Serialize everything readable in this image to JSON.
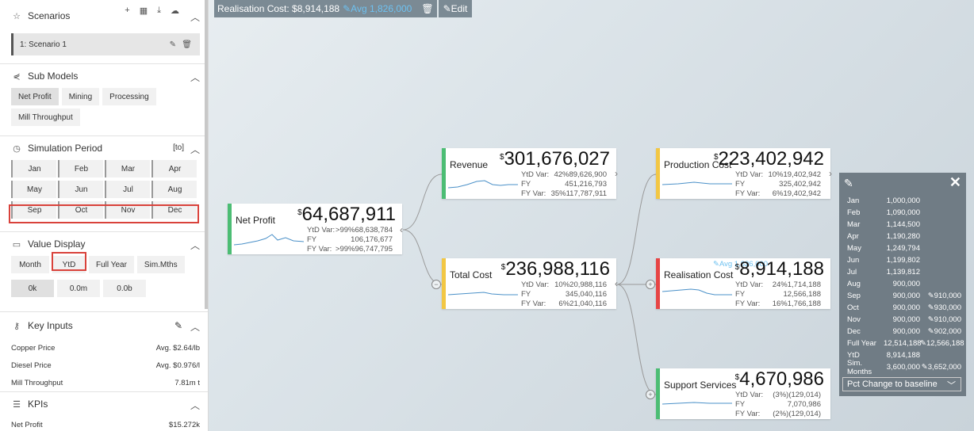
{
  "topbar": {
    "realisation": "Realisation Cost: $8,914,188",
    "avg": "Avg 1,826,000",
    "edit": "Edit"
  },
  "sidebar": {
    "scenarios": {
      "title": "Scenarios",
      "item": "1: Scenario 1"
    },
    "submodels": {
      "title": "Sub Models",
      "items": [
        "Net Profit",
        "Mining",
        "Processing",
        "Mill Throughput"
      ]
    },
    "period": {
      "title": "Simulation Period",
      "to": "[to]",
      "months": [
        "Jan",
        "Feb",
        "Mar",
        "Apr",
        "May",
        "Jun",
        "Jul",
        "Aug",
        "Sep",
        "Oct",
        "Nov",
        "Dec"
      ]
    },
    "value_display": {
      "title": "Value Display",
      "modes": [
        "Month",
        "YtD",
        "Full Year",
        "Sim.Mths"
      ],
      "scales": [
        "0k",
        "0.0m",
        "0.0b"
      ]
    },
    "key_inputs": {
      "title": "Key Inputs",
      "rows": [
        {
          "k": "Copper Price",
          "v": "Avg. $2.64/lb"
        },
        {
          "k": "Diesel Price",
          "v": "Avg. $0.976/l"
        },
        {
          "k": "Mill Throughput",
          "v": "7.81m t"
        }
      ]
    },
    "kpis": {
      "title": "KPIs",
      "rows": [
        {
          "k": "Net Profit",
          "v": "$15.272k"
        }
      ]
    }
  },
  "cards": {
    "net_profit": {
      "name": "Net Profit",
      "value": "64,687,911",
      "color": "#4cbd74",
      "rows": [
        [
          "YtD Var:",
          ">99%",
          "68,638,784"
        ],
        [
          "FY",
          "",
          "106,176,677"
        ],
        [
          "FY Var:",
          ">99%",
          "96,747,795"
        ]
      ]
    },
    "revenue": {
      "name": "Revenue",
      "value": "301,676,027",
      "color": "#4cbd74",
      "rows": [
        [
          "YtD Var:",
          "42%",
          "89,626,900"
        ],
        [
          "FY",
          "",
          "451,216,793"
        ],
        [
          "FY Var:",
          "35%",
          "117,787,911"
        ]
      ]
    },
    "total_cost": {
      "name": "Total Cost",
      "value": "236,988,116",
      "color": "#f2c744",
      "rows": [
        [
          "YtD Var:",
          "10%",
          "20,988,116"
        ],
        [
          "FY",
          "",
          "345,040,116"
        ],
        [
          "FY Var:",
          "6%",
          "21,040,116"
        ]
      ]
    },
    "production_cost": {
      "name": "Production Cost",
      "value": "223,402,942",
      "color": "#f2c744",
      "rows": [
        [
          "YtD Var:",
          "10%",
          "19,402,942"
        ],
        [
          "FY",
          "",
          "325,402,942"
        ],
        [
          "FY Var:",
          "6%",
          "19,402,942"
        ]
      ]
    },
    "realisation_cost": {
      "name": "Realisation Cost",
      "value": "8,914,188",
      "color": "#e64545",
      "avg": "Avg 1,826,000",
      "rows": [
        [
          "YtD Var:",
          "24%",
          "1,714,188"
        ],
        [
          "FY",
          "",
          "12,566,188"
        ],
        [
          "FY Var:",
          "16%",
          "1,766,188"
        ]
      ]
    },
    "support_services": {
      "name": "Support Services",
      "value": "4,670,986",
      "color": "#4cbd74",
      "rows": [
        [
          "YtD Var:",
          "(3%)",
          "(129,014)"
        ],
        [
          "FY",
          "",
          "7,070,986"
        ],
        [
          "FY Var:",
          "(2%)",
          "(129,014)"
        ]
      ]
    }
  },
  "currency": "$",
  "popup": {
    "rows": [
      {
        "k": "Jan",
        "v": "1,000,000",
        "e": ""
      },
      {
        "k": "Feb",
        "v": "1,090,000",
        "e": ""
      },
      {
        "k": "Mar",
        "v": "1,144,500",
        "e": ""
      },
      {
        "k": "Apr",
        "v": "1,190,280",
        "e": ""
      },
      {
        "k": "May",
        "v": "1,249,794",
        "e": ""
      },
      {
        "k": "Jun",
        "v": "1,199,802",
        "e": ""
      },
      {
        "k": "Jul",
        "v": "1,139,812",
        "e": ""
      },
      {
        "k": "Aug",
        "v": "900,000",
        "e": ""
      },
      {
        "k": "Sep",
        "v": "900,000",
        "e": "910,000"
      },
      {
        "k": "Oct",
        "v": "900,000",
        "e": "930,000"
      },
      {
        "k": "Nov",
        "v": "900,000",
        "e": "910,000"
      },
      {
        "k": "Dec",
        "v": "900,000",
        "e": "902,000"
      },
      {
        "k": "Full Year",
        "v": "12,514,188",
        "e": "12,566,188"
      },
      {
        "k": "YtD",
        "v": "8,914,188",
        "e": ""
      },
      {
        "k": "Sim. Months",
        "v": "3,600,000",
        "e": "3,652,000"
      }
    ],
    "select": "Pct Change to baseline"
  }
}
